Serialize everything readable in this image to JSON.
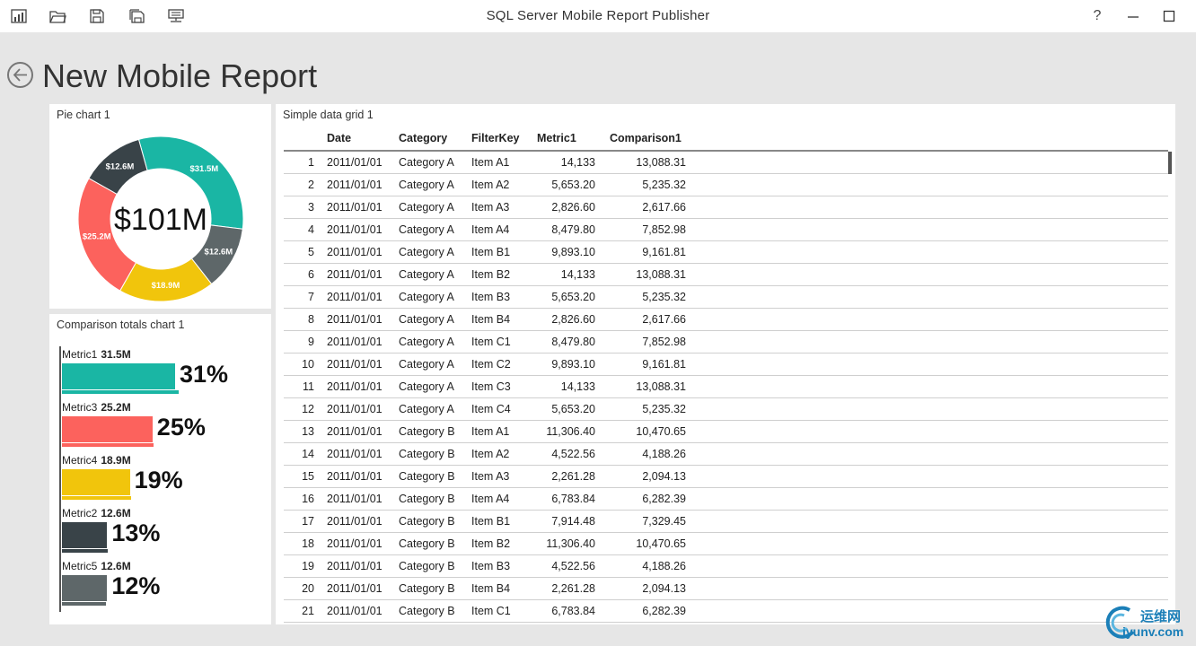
{
  "app": {
    "title": "SQL Server Mobile Report Publisher",
    "help": "?",
    "minimize": "—",
    "maximize": "☐"
  },
  "toolbar": {
    "icons": [
      "layout-icon",
      "open-folder-icon",
      "save-icon",
      "save-as-icon",
      "publish-server-icon"
    ]
  },
  "page": {
    "title": "New Mobile Report"
  },
  "pie_chart": {
    "title": "Pie chart 1",
    "center_label": "$101M",
    "chart_data": {
      "type": "pie",
      "title": "Pie chart 1",
      "categories": [
        "Metric1",
        "Metric5",
        "Metric4",
        "Metric3",
        "Metric2"
      ],
      "values": [
        31.5,
        12.6,
        18.9,
        25.2,
        12.6
      ],
      "labels": [
        "$31.5M",
        "$12.6M",
        "$18.9M",
        "$25.2M",
        "$12.6M"
      ],
      "colors": [
        "#1ab6a4",
        "#5e6769",
        "#f1c50c",
        "#fc625d",
        "#394348"
      ],
      "total_label": "$101M"
    }
  },
  "comparison_chart": {
    "title": "Comparison totals chart 1",
    "chart_data": {
      "type": "bar",
      "title": "Comparison totals chart 1",
      "categories": [
        "Metric1",
        "Metric3",
        "Metric4",
        "Metric2",
        "Metric5"
      ],
      "values": [
        31.5,
        25.2,
        18.9,
        12.6,
        12.6
      ],
      "value_labels": [
        "31.5M",
        "25.2M",
        "18.9M",
        "12.6M",
        "12.6M"
      ],
      "percent_labels": [
        "31%",
        "25%",
        "19%",
        "13%",
        "12%"
      ],
      "comparison_values": [
        32.5,
        25.6,
        19.3,
        12.7,
        12.3
      ],
      "colors": [
        "#1ab6a4",
        "#fc625d",
        "#f1c50c",
        "#394348",
        "#5e6769"
      ]
    }
  },
  "data_grid": {
    "title": "Simple data grid 1",
    "columns": [
      "",
      "Date",
      "Category",
      "FilterKey",
      "Metric1",
      "Comparison1"
    ],
    "rows": [
      [
        "1",
        "2011/01/01",
        "Category A",
        "Item A1",
        "14,133",
        "13,088.31"
      ],
      [
        "2",
        "2011/01/01",
        "Category A",
        "Item A2",
        "5,653.20",
        "5,235.32"
      ],
      [
        "3",
        "2011/01/01",
        "Category A",
        "Item A3",
        "2,826.60",
        "2,617.66"
      ],
      [
        "4",
        "2011/01/01",
        "Category A",
        "Item A4",
        "8,479.80",
        "7,852.98"
      ],
      [
        "5",
        "2011/01/01",
        "Category A",
        "Item B1",
        "9,893.10",
        "9,161.81"
      ],
      [
        "6",
        "2011/01/01",
        "Category A",
        "Item B2",
        "14,133",
        "13,088.31"
      ],
      [
        "7",
        "2011/01/01",
        "Category A",
        "Item B3",
        "5,653.20",
        "5,235.32"
      ],
      [
        "8",
        "2011/01/01",
        "Category A",
        "Item B4",
        "2,826.60",
        "2,617.66"
      ],
      [
        "9",
        "2011/01/01",
        "Category A",
        "Item C1",
        "8,479.80",
        "7,852.98"
      ],
      [
        "10",
        "2011/01/01",
        "Category A",
        "Item C2",
        "9,893.10",
        "9,161.81"
      ],
      [
        "11",
        "2011/01/01",
        "Category A",
        "Item C3",
        "14,133",
        "13,088.31"
      ],
      [
        "12",
        "2011/01/01",
        "Category A",
        "Item C4",
        "5,653.20",
        "5,235.32"
      ],
      [
        "13",
        "2011/01/01",
        "Category B",
        "Item A1",
        "11,306.40",
        "10,470.65"
      ],
      [
        "14",
        "2011/01/01",
        "Category B",
        "Item A2",
        "4,522.56",
        "4,188.26"
      ],
      [
        "15",
        "2011/01/01",
        "Category B",
        "Item A3",
        "2,261.28",
        "2,094.13"
      ],
      [
        "16",
        "2011/01/01",
        "Category B",
        "Item A4",
        "6,783.84",
        "6,282.39"
      ],
      [
        "17",
        "2011/01/01",
        "Category B",
        "Item B1",
        "7,914.48",
        "7,329.45"
      ],
      [
        "18",
        "2011/01/01",
        "Category B",
        "Item B2",
        "11,306.40",
        "10,470.65"
      ],
      [
        "19",
        "2011/01/01",
        "Category B",
        "Item B3",
        "4,522.56",
        "4,188.26"
      ],
      [
        "20",
        "2011/01/01",
        "Category B",
        "Item B4",
        "2,261.28",
        "2,094.13"
      ],
      [
        "21",
        "2011/01/01",
        "Category B",
        "Item C1",
        "6,783.84",
        "6,282.39"
      ]
    ]
  },
  "watermark": {
    "line1": "运维网",
    "line2": "iyunv.com"
  }
}
